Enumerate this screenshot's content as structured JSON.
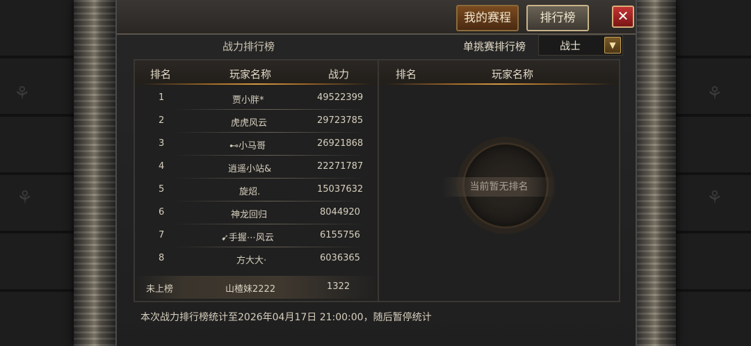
{
  "tabs": {
    "schedule_label": "我的赛程",
    "ranking_label": "排行榜"
  },
  "close_label": "✕",
  "left_panel": {
    "title": "战力排行榜",
    "headers": {
      "rank": "排名",
      "name": "玩家名称",
      "power": "战力"
    },
    "rows": [
      {
        "rank": "1",
        "name": "贾小胖*",
        "power": "49522399"
      },
      {
        "rank": "2",
        "name": "虎虎风云",
        "power": "29723785"
      },
      {
        "rank": "3",
        "name": "⊷小马哥",
        "power": "26921868"
      },
      {
        "rank": "4",
        "name": "逍遥小站&",
        "power": "22271787"
      },
      {
        "rank": "5",
        "name": "旋炤.",
        "power": "15037632"
      },
      {
        "rank": "6",
        "name": "神龙回归",
        "power": "8044920"
      },
      {
        "rank": "7",
        "name": "➹手握⋯风云",
        "power": "6155756"
      },
      {
        "rank": "8",
        "name": "方大大·",
        "power": "6036365"
      }
    ],
    "me": {
      "rank": "未上榜",
      "name": "山楂妹2222",
      "power": "1322"
    }
  },
  "right_panel": {
    "title": "单挑赛排行榜",
    "class_select": "战士",
    "headers": {
      "rank": "排名",
      "name": "玩家名称"
    },
    "empty_text": "当前暂无排名"
  },
  "footer_text": "本次战力排行榜统计至2026年04月17日 21:00:00，随后暂停统计",
  "colors": {
    "accent": "#d69a45",
    "close": "#c43434"
  }
}
